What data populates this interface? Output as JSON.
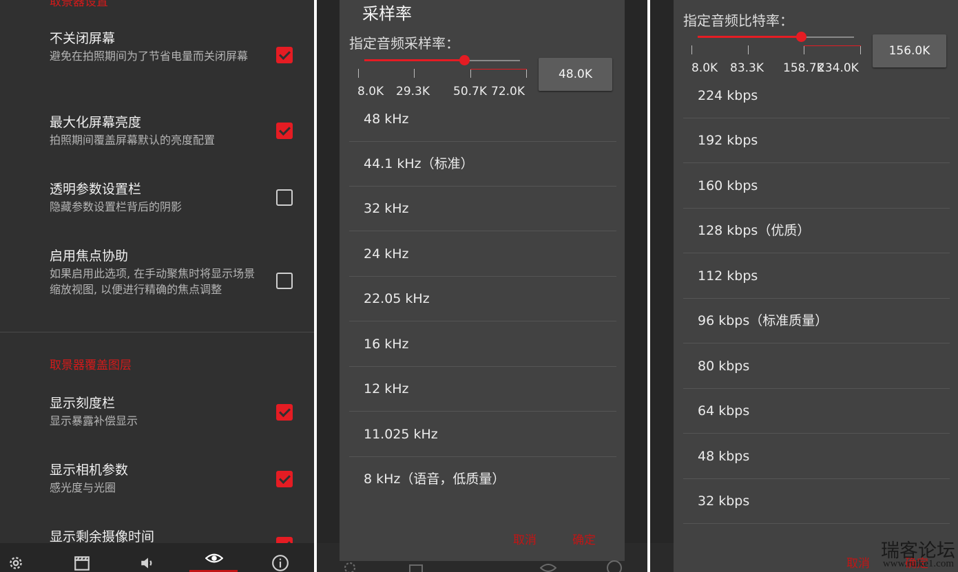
{
  "panel1": {
    "section_top": "取景器设置",
    "settings": [
      {
        "title": "不关闭屏幕",
        "subtitle": "避免在拍照期间为了节省电量而关闭屏幕",
        "checked": true
      },
      {
        "title": "最大化屏幕亮度",
        "subtitle": "拍照期间覆盖屏幕默认的亮度配置",
        "checked": true
      },
      {
        "title": "透明参数设置栏",
        "subtitle": "隐藏参数设置栏背后的阴影",
        "checked": false
      },
      {
        "title": "启用焦点协助",
        "subtitle": "如果启用此选项, 在手动聚焦时将显示场景缩放视图, 以便进行精确的焦点调整",
        "checked": false
      }
    ],
    "section_overlay": "取景器覆盖图层",
    "overlay_settings": [
      {
        "title": "显示刻度栏",
        "subtitle": "显示暴露补偿显示",
        "checked": true
      },
      {
        "title": "显示相机参数",
        "subtitle": "感光度与光圈",
        "checked": true
      },
      {
        "title": "显示剩余摄像时间",
        "subtitle": "",
        "checked": true
      }
    ],
    "bottom_nav": [
      "gear-icon",
      "clapper-icon",
      "speaker-icon",
      "eye-icon",
      "info-icon"
    ],
    "accent": "#e51c23"
  },
  "panel2": {
    "title": "采样率",
    "prompt": "指定音频采样率：",
    "slider_value": 0.64,
    "ticks": [
      "8.0K",
      "29.3K",
      "50.7K",
      "72.0K"
    ],
    "value_button": "48.0K",
    "options": [
      "48 kHz",
      "44.1 kHz（标准）",
      "32 kHz",
      "24 kHz",
      "22.05 kHz",
      "16 kHz",
      "12 kHz",
      "11.025 kHz",
      "8 kHz（语音，低质量）"
    ],
    "cancel": "取消",
    "ok": "确定"
  },
  "panel3": {
    "prompt": "指定音频比特率：",
    "slider_value": 0.66,
    "ticks": [
      "8.0K",
      "83.3K",
      "158.7K",
      "234.0K"
    ],
    "value_button": "156.0K",
    "options": [
      "224 kbps",
      "192 kbps",
      "160 kbps",
      "128 kbps（优质）",
      "112 kbps",
      "96 kbps（标准质量）",
      "80 kbps",
      "64 kbps",
      "48 kbps",
      "32 kbps"
    ],
    "cancel": "取消",
    "ok": "确定"
  },
  "watermark": {
    "cn": "瑞客论坛",
    "en": "www.ruike1.com"
  }
}
